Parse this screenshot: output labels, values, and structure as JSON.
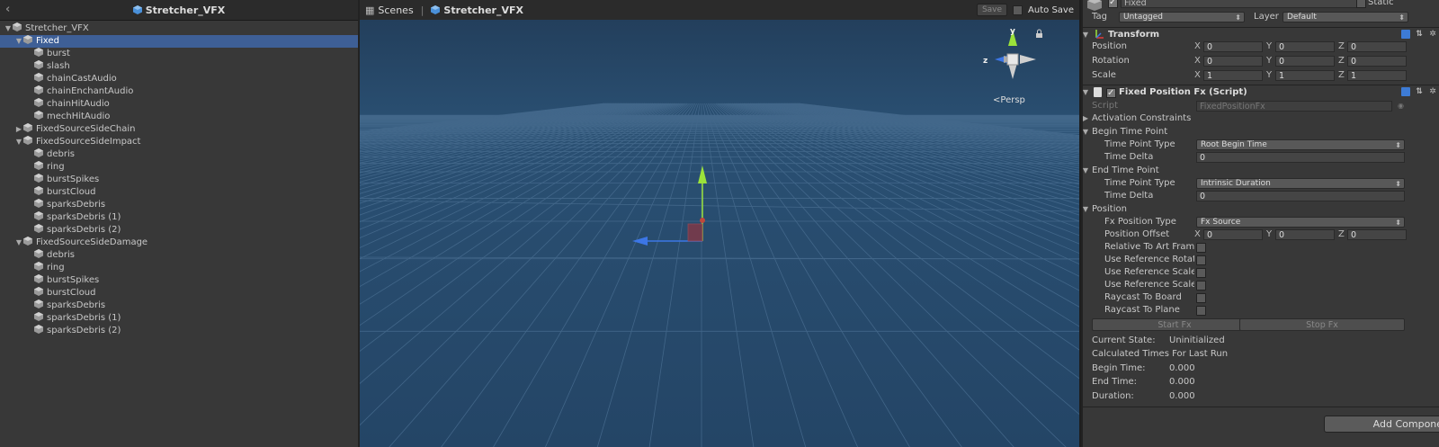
{
  "hierarchy": {
    "title": "Stretcher_VFX",
    "items": [
      {
        "label": "Stretcher_VFX",
        "depth": 0,
        "expand": "open",
        "selected": false
      },
      {
        "label": "Fixed",
        "depth": 1,
        "expand": "open",
        "selected": true
      },
      {
        "label": "burst",
        "depth": 2,
        "expand": "none",
        "selected": false
      },
      {
        "label": "slash",
        "depth": 2,
        "expand": "none",
        "selected": false
      },
      {
        "label": "chainCastAudio",
        "depth": 2,
        "expand": "none",
        "selected": false
      },
      {
        "label": "chainEnchantAudio",
        "depth": 2,
        "expand": "none",
        "selected": false
      },
      {
        "label": "chainHitAudio",
        "depth": 2,
        "expand": "none",
        "selected": false
      },
      {
        "label": "mechHitAudio",
        "depth": 2,
        "expand": "none",
        "selected": false
      },
      {
        "label": "FixedSourceSideChain",
        "depth": 1,
        "expand": "closed",
        "selected": false
      },
      {
        "label": "FixedSourceSideImpact",
        "depth": 1,
        "expand": "open",
        "selected": false
      },
      {
        "label": "debris",
        "depth": 2,
        "expand": "none",
        "selected": false
      },
      {
        "label": "ring",
        "depth": 2,
        "expand": "none",
        "selected": false
      },
      {
        "label": "burstSpikes",
        "depth": 2,
        "expand": "none",
        "selected": false
      },
      {
        "label": "burstCloud",
        "depth": 2,
        "expand": "none",
        "selected": false
      },
      {
        "label": "sparksDebris",
        "depth": 2,
        "expand": "none",
        "selected": false
      },
      {
        "label": "sparksDebris (1)",
        "depth": 2,
        "expand": "none",
        "selected": false
      },
      {
        "label": "sparksDebris (2)",
        "depth": 2,
        "expand": "none",
        "selected": false
      },
      {
        "label": "FixedSourceSideDamage",
        "depth": 1,
        "expand": "open",
        "selected": false
      },
      {
        "label": "debris",
        "depth": 2,
        "expand": "none",
        "selected": false
      },
      {
        "label": "ring",
        "depth": 2,
        "expand": "none",
        "selected": false
      },
      {
        "label": "burstSpikes",
        "depth": 2,
        "expand": "none",
        "selected": false
      },
      {
        "label": "burstCloud",
        "depth": 2,
        "expand": "none",
        "selected": false
      },
      {
        "label": "sparksDebris",
        "depth": 2,
        "expand": "none",
        "selected": false
      },
      {
        "label": "sparksDebris (1)",
        "depth": 2,
        "expand": "none",
        "selected": false
      },
      {
        "label": "sparksDebris (2)",
        "depth": 2,
        "expand": "none",
        "selected": false
      }
    ]
  },
  "scene": {
    "breadcrumb_root": "Scenes",
    "breadcrumb_current": "Stretcher_VFX",
    "save_label": "Save",
    "auto_save_label": "Auto Save",
    "gizmo_y": "y",
    "gizmo_z": "z",
    "projection_label": "Persp"
  },
  "inspector": {
    "object_name": "Fixed",
    "static_label": "Static",
    "tag_label": "Tag",
    "tag_value": "Untagged",
    "layer_label": "Layer",
    "layer_value": "Default",
    "transform": {
      "title": "Transform",
      "position_label": "Position",
      "position": [
        "0",
        "0",
        "0"
      ],
      "rotation_label": "Rotation",
      "rotation": [
        "0",
        "0",
        "0"
      ],
      "scale_label": "Scale",
      "scale": [
        "1",
        "1",
        "1"
      ]
    },
    "axis_labels": [
      "X",
      "Y",
      "Z"
    ],
    "script_comp": {
      "title": "Fixed Position Fx (Script)",
      "script_label": "Script",
      "script_value": "FixedPositionFx",
      "activation_label": "Activation Constraints",
      "begin_label": "Begin Time Point",
      "begin_type_label": "Time Point Type",
      "begin_type_value": "Root Begin Time",
      "begin_delta_label": "Time Delta",
      "begin_delta_value": "0",
      "end_label": "End Time Point",
      "end_type_label": "Time Point Type",
      "end_type_value": "Intrinsic Duration",
      "end_delta_label": "Time Delta",
      "end_delta_value": "0",
      "position_label": "Position",
      "fx_pos_type_label": "Fx Position Type",
      "fx_pos_type_value": "Fx Source",
      "pos_offset_label": "Position Offset",
      "pos_offset": [
        "0",
        "0",
        "0"
      ],
      "rel_art_label": "Relative To Art Frame",
      "use_ref_rot_label": "Use Reference Rotation",
      "use_ref_scale_label": "Use Reference Scale",
      "use_ref_scale_abs_label": "Use Reference Scale Abso",
      "raycast_board_label": "Raycast To Board",
      "raycast_plane_label": "Raycast To Plane",
      "start_fx_label": "Start Fx",
      "stop_fx_label": "Stop Fx",
      "current_state_label": "Current State:",
      "current_state_value": "Uninitialized",
      "calc_times_label": "Calculated Times For Last Run",
      "begin_time_label": "Begin Time:",
      "begin_time_value": "0.000",
      "end_time_label": "End Time:",
      "end_time_value": "0.000",
      "duration_label": "Duration:",
      "duration_value": "0.000"
    },
    "add_component_label": "Add Component"
  },
  "colors": {
    "selection": "#3e5f96",
    "scene_bg": "#254666",
    "panel_bg": "#383838",
    "axis_y": "#9be23a",
    "axis_z": "#3c76e6",
    "axis_x": "#e23a3a"
  }
}
